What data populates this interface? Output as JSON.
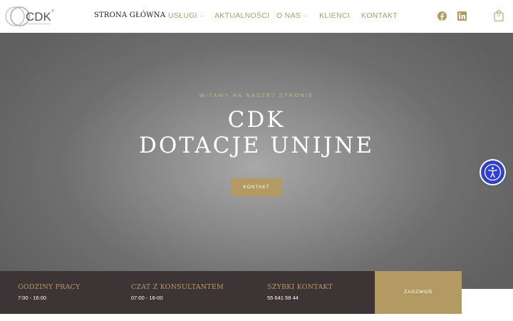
{
  "header": {
    "logo_text": "CDK",
    "nav": [
      {
        "label": "STRONA GŁÓWNA",
        "active": true,
        "dropdown": false
      },
      {
        "label": "USŁUGI",
        "active": false,
        "dropdown": true
      },
      {
        "label": "AKTUALNOŚCI",
        "active": false,
        "dropdown": false
      },
      {
        "label": "O NAS",
        "active": false,
        "dropdown": true
      },
      {
        "label": "KLIENCI",
        "active": false,
        "dropdown": false
      },
      {
        "label": "KONTAKT",
        "active": false,
        "dropdown": false
      }
    ],
    "social_icons": [
      "facebook-icon",
      "linkedin-icon"
    ],
    "cart_count": "0"
  },
  "hero": {
    "kicker": "WITAMY NA NASZEJ STRONIE",
    "title_line1": "CDK",
    "title_line2": "DOTACJE UNIJNE",
    "button_label": "KONTAKT"
  },
  "infobar": {
    "items": [
      {
        "title": "GODZINY PRACY",
        "value": "7:00 - 16:00"
      },
      {
        "title": "CZAT Z KONSULTANTEM",
        "value": "07:00 - 16-00"
      },
      {
        "title": "SZYBKI KONTAKT",
        "value": "55 641 58 44"
      }
    ],
    "call_label": "ZADZWOŃ"
  },
  "accessibility_icon": "accessibility-icon",
  "colors": {
    "accent": "#b39a63",
    "dark": "#3d3535",
    "a11y_blue": "#2f3fd6"
  }
}
